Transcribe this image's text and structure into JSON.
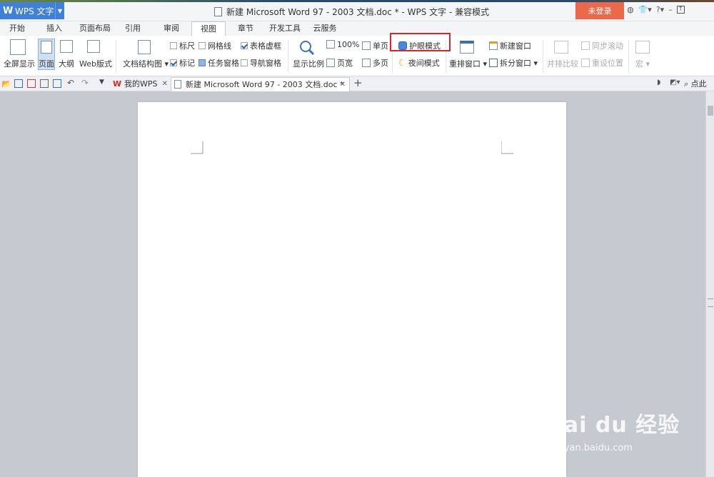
{
  "app": {
    "name": "WPS 文字",
    "login": "未登录"
  },
  "window": {
    "title": "新建 Microsoft Word 97 - 2003 文档.doc * - WPS 文字 - 兼容模式"
  },
  "menu": {
    "tabs": [
      "开始",
      "插入",
      "页面布局",
      "引用",
      "审阅",
      "视图",
      "章节",
      "开发工具",
      "云服务"
    ],
    "active": "视图"
  },
  "ribbon": {
    "fullscreen": "全屏显示",
    "page": "页面",
    "outline": "大纲",
    "web": "Web版式",
    "docmap": "文档结构图",
    "ruler": "标尺",
    "gridlines": "网格线",
    "tablegrid": "表格虚框",
    "marks": "标记",
    "taskpane": "任务窗格",
    "navpane": "导航窗格",
    "zoom": "显示比例",
    "zoom100": "100%",
    "pagewidth": "页宽",
    "single": "单页",
    "multi": "多页",
    "eyecare": "护眼模式",
    "night": "夜间模式",
    "arrange": "重排窗口",
    "newwin": "新建窗口",
    "split": "拆分窗口",
    "sidebyside": "并排比较",
    "syncscroll": "同步滚动",
    "resetpos": "重设位置",
    "macro": "宏"
  },
  "doctabs": {
    "home": "我的WPS",
    "doc": "新建 Microsoft Word 97 - 2003 文档.doc *",
    "search": "点此查"
  },
  "watermark": {
    "brand": "Bai du 经验",
    "url": "jingyan.baidu.com"
  },
  "colors": {
    "accent": "#3f80d9",
    "login": "#e9694a",
    "highlight": "#d9262a"
  }
}
